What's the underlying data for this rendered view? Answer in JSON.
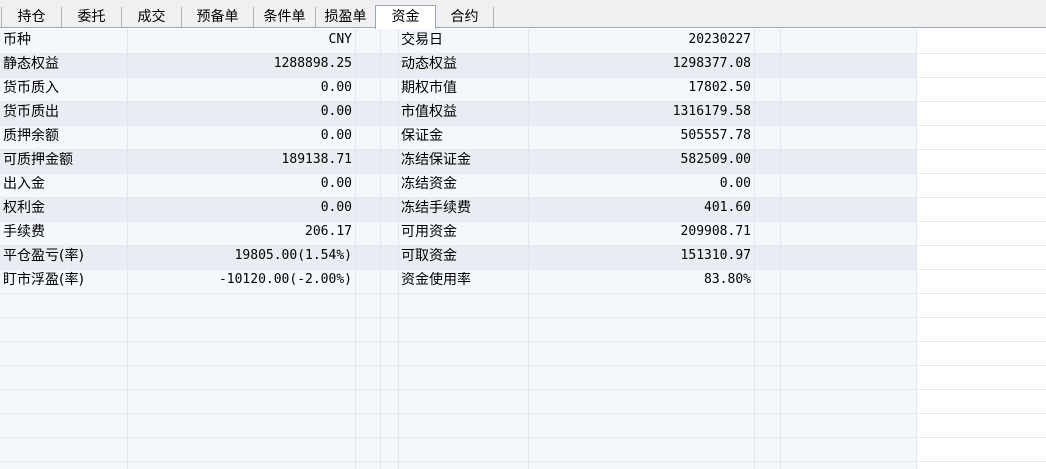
{
  "tabs": [
    {
      "label": "持仓",
      "active": false
    },
    {
      "label": "委托",
      "active": false
    },
    {
      "label": "成交",
      "active": false
    },
    {
      "label": "预备单",
      "active": false
    },
    {
      "label": "条件单",
      "active": false
    },
    {
      "label": "损盈单",
      "active": false
    },
    {
      "label": "资金",
      "active": true
    },
    {
      "label": "合约",
      "active": false
    }
  ],
  "funds": {
    "rows": [
      {
        "left_label": "币种",
        "left_value": "CNY",
        "right_label": "交易日",
        "right_value": "20230227"
      },
      {
        "left_label": "静态权益",
        "left_value": "1288898.25",
        "right_label": "动态权益",
        "right_value": "1298377.08"
      },
      {
        "left_label": "货币质入",
        "left_value": "0.00",
        "right_label": "期权市值",
        "right_value": "17802.50"
      },
      {
        "left_label": "货币质出",
        "left_value": "0.00",
        "right_label": "市值权益",
        "right_value": "1316179.58"
      },
      {
        "left_label": "质押余额",
        "left_value": "0.00",
        "right_label": "保证金",
        "right_value": "505557.78"
      },
      {
        "left_label": "可质押金额",
        "left_value": "189138.71",
        "right_label": "冻结保证金",
        "right_value": "582509.00"
      },
      {
        "left_label": "出入金",
        "left_value": "0.00",
        "right_label": "冻结资金",
        "right_value": "0.00"
      },
      {
        "left_label": "权利金",
        "left_value": "0.00",
        "right_label": "冻结手续费",
        "right_value": "401.60"
      },
      {
        "left_label": "手续费",
        "left_value": "206.17",
        "right_label": "可用资金",
        "right_value": "209908.71"
      },
      {
        "left_label": "平仓盈亏(率)",
        "left_value": "19805.00(1.54%)",
        "right_label": "可取资金",
        "right_value": "151310.97"
      },
      {
        "left_label": "盯市浮盈(率)",
        "left_value": "-10120.00(-2.00%)",
        "right_label": "资金使用率",
        "right_value": "83.80%"
      }
    ]
  },
  "colors": {
    "grid_background": "#f4f8fc",
    "band_row": "#e9edf3",
    "tabbar_background": "#f0f0f0",
    "active_tab": "#ffffff"
  }
}
